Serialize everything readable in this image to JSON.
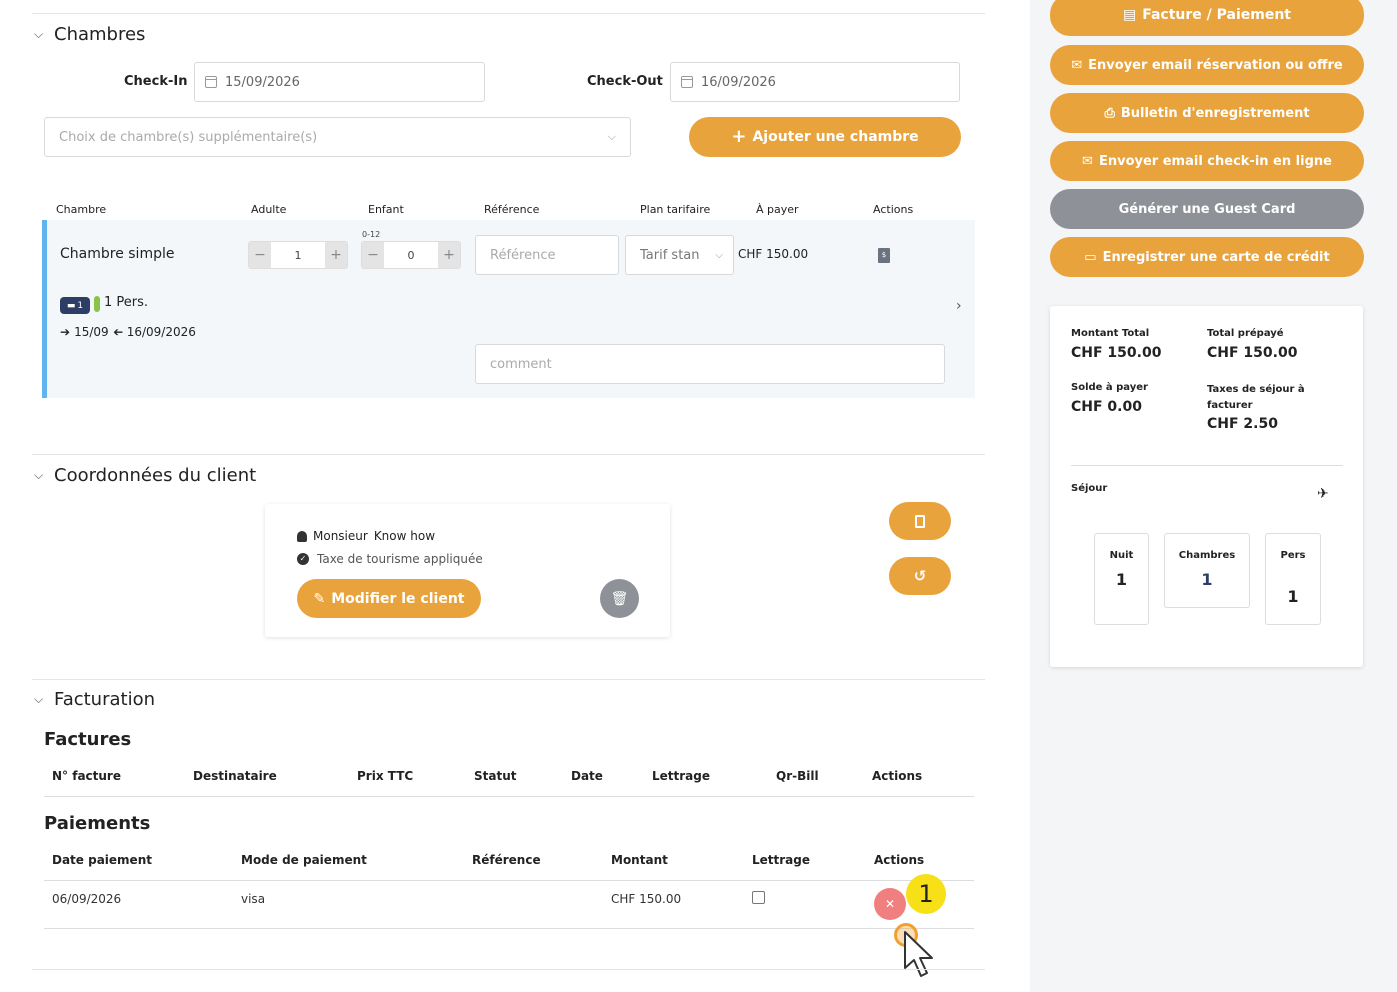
{
  "rooms_section": {
    "title": "Chambres",
    "checkin_label": "Check-In",
    "checkin_value": "15/09/2026",
    "checkout_label": "Check-Out",
    "checkout_value": "16/09/2026",
    "extra_rooms_placeholder": "Choix de chambre(s) supplémentaire(s)",
    "add_room_label": "Ajouter une chambre",
    "table_headers": [
      "Chambre",
      "Adulte",
      "Enfant",
      "Référence",
      "Plan tarifaire",
      "À payer",
      "Actions"
    ],
    "child_age_range": "0-12",
    "row": {
      "room_name": "Chambre simple",
      "adults": "1",
      "children": "0",
      "reference_placeholder": "Référence",
      "rate_plan": "Tarif stan",
      "amount": "CHF 150.00",
      "bed_count": "1",
      "persons": "1 Pers.",
      "dates": "15/09",
      "dates_end": "16/09/2026",
      "comment_placeholder": "comment"
    }
  },
  "client_section": {
    "title": "Coordonnées du client",
    "salutation": "Monsieur",
    "name": "Know how",
    "tax_note": "Taxe de tourisme appliquée",
    "edit_label": "Modifier le client"
  },
  "billing_section": {
    "title": "Facturation",
    "invoices_title": "Factures",
    "invoice_headers": [
      "N° facture",
      "Destinataire",
      "Prix TTC",
      "Statut",
      "Date",
      "Lettrage",
      "Qr-Bill",
      "Actions"
    ],
    "payments_title": "Paiements",
    "payment_headers": [
      "Date paiement",
      "Mode de paiement",
      "Référence",
      "Montant",
      "Lettrage",
      "Actions"
    ],
    "payments": [
      {
        "date": "06/09/2026",
        "mode": "visa",
        "reference": "",
        "amount": "CHF 150.00"
      }
    ],
    "badge_number": "1"
  },
  "sidebar": {
    "buttons": [
      "Facture / Paiement",
      "Envoyer email réservation ou offre",
      "Bulletin d'enregistrement",
      "Envoyer email check-in en ligne",
      "Générer une Guest Card",
      "Enregistrer une carte de crédit"
    ],
    "summary": {
      "total_label": "Montant Total",
      "total_value": "CHF 150.00",
      "prepaid_label": "Total prépayé",
      "prepaid_value": "CHF 150.00",
      "balance_label": "Solde à payer",
      "balance_value": "CHF 0.00",
      "tax_label": "Taxes de séjour à facturer",
      "tax_value": "CHF 2.50",
      "stay_label": "Séjour",
      "nights_label": "Nuit",
      "nights_value": "1",
      "rooms_label": "Chambres",
      "rooms_value": "1",
      "pers_label": "Pers",
      "pers_value": "1"
    }
  },
  "colors": {
    "accent": "#e8a33d",
    "gray_button": "#8e9197",
    "row_bar": "#5fb4f0",
    "delete": "#f08080",
    "badge": "#f7e017"
  }
}
